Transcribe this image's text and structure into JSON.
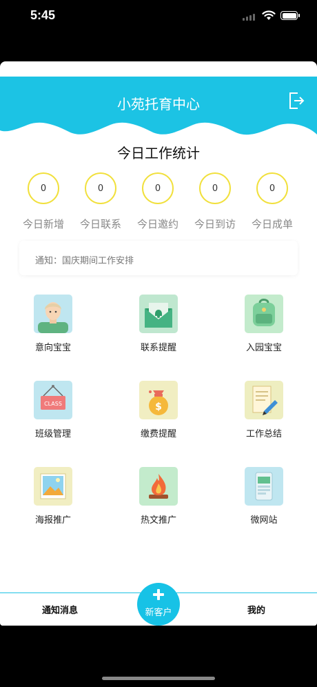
{
  "status_bar": {
    "time": "5:45"
  },
  "header": {
    "title": "小苑托育中心",
    "icon": "logout-icon",
    "color": "#1cc3e4"
  },
  "stats_section": {
    "title": "今日工作统计",
    "accent": "#f1e03c",
    "items": [
      {
        "value": "0",
        "label": "今日新增"
      },
      {
        "value": "0",
        "label": "今日联系"
      },
      {
        "value": "0",
        "label": "今日邀约"
      },
      {
        "value": "0",
        "label": "今日到访"
      },
      {
        "value": "0",
        "label": "今日成单"
      }
    ]
  },
  "notice": {
    "text": "通知：国庆期间工作安排"
  },
  "menu": [
    {
      "label": "意向宝宝",
      "icon": "baby-avatar-icon"
    },
    {
      "label": "联系提醒",
      "icon": "envelope-bell-icon"
    },
    {
      "label": "入园宝宝",
      "icon": "backpack-icon"
    },
    {
      "label": "班级管理",
      "icon": "class-sign-icon",
      "icon_text": "CLASS"
    },
    {
      "label": "缴费提醒",
      "icon": "money-bag-icon",
      "icon_text": "$"
    },
    {
      "label": "工作总结",
      "icon": "document-pen-icon"
    },
    {
      "label": "海报推广",
      "icon": "poster-picture-icon"
    },
    {
      "label": "热文推广",
      "icon": "fire-icon"
    },
    {
      "label": "微网站",
      "icon": "mobile-site-icon"
    }
  ],
  "tabbar": {
    "left": "通知消息",
    "center": "新客户",
    "right": "我的",
    "accent": "#17c2e6"
  }
}
